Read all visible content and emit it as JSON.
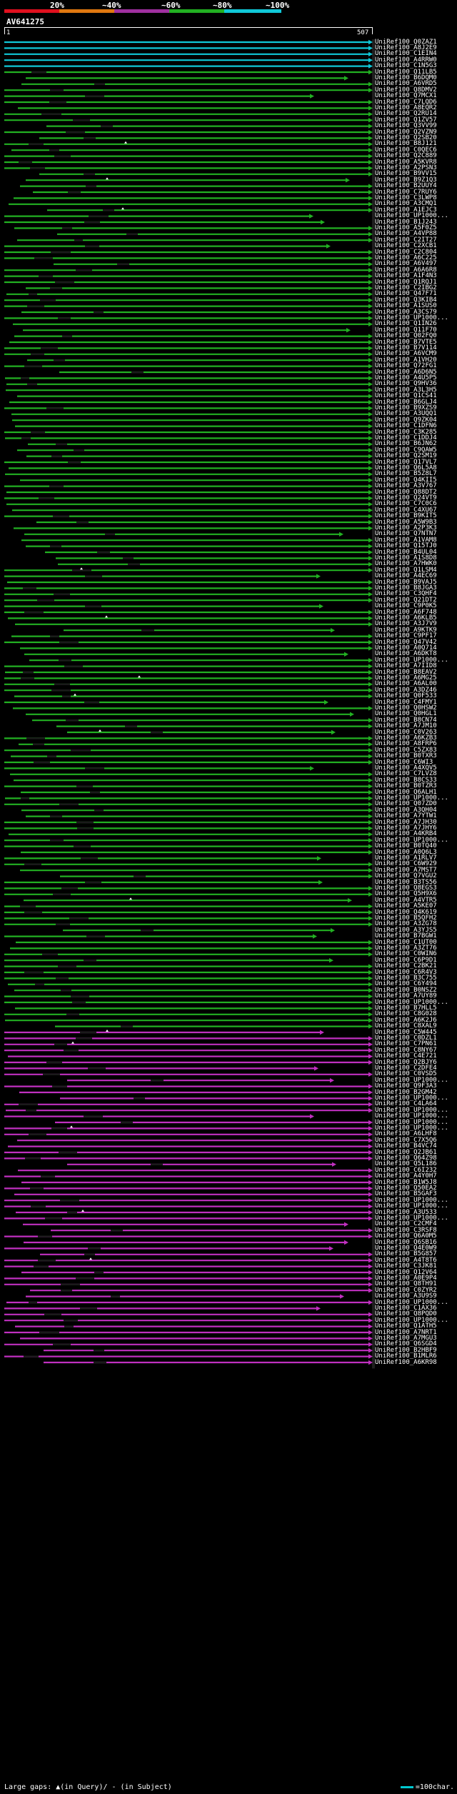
{
  "query_id": "AV641275",
  "ruler": {
    "start": "1",
    "end": "507"
  },
  "identity_legend": [
    {
      "label": "20%",
      "color": "#e0101e"
    },
    {
      "label": "~40%",
      "color": "#e07810"
    },
    {
      "label": "~60%",
      "color": "#a030a0"
    },
    {
      "label": "~80%",
      "color": "#22b022"
    },
    {
      "label": "~100%",
      "color": "#10c8d8"
    }
  ],
  "footer": {
    "gaps_text": "Large gaps: ▲(in Query)/ - (in Subject)",
    "scale_text": "=100char."
  },
  "hits": [
    "UniRef100_Q0ZAZ1",
    "UniRef100_A8J2E9",
    "UniRef100_C1EIN4",
    "UniRef100_A4RRW0",
    "UniRef100_C1N5G3",
    "UniRef100_Q11LB5",
    "UniRef100_B6DQM0",
    "UniRef100_A6VRD5",
    "UniRef100_Q8DMV2",
    "UniRef100_Q7MCX1",
    "UniRef100_C7LQD6",
    "UniRef100_A8EQR2",
    "UniRef100_Q2RU14",
    "UniRef100_Q1ZV57",
    "UniRef100_Q3VV99",
    "UniRef100_Q2VZN9",
    "UniRef100_Q2SB20",
    "UniRef100_B8J121",
    "UniRef100_C0QEC6",
    "UniRef100_Q2C889",
    "UniRef100_A5KVR8",
    "UniRef100_A2PSN3",
    "UniRef100_B9VV15",
    "UniRef100_B9Z1Q3",
    "UniRef100_B2UUY4",
    "UniRef100_C7RUY6",
    "UniRef100_C3LWP8",
    "UniRef100_A3CMQ1",
    "UniRef100_A1EJC3",
    "UniRef100_UP1000...",
    "UniRef100_B1J243",
    "UniRef100_A5F0Z5",
    "UniRef100_A4VP88",
    "UniRef100_C2IT27",
    "UniRef100_C2XCB1",
    "UniRef100_C2C804",
    "UniRef100_A6C225",
    "UniRef100_A6V497",
    "UniRef100_A6A6R8",
    "UniRef100_A1F4N3",
    "UniRef100_Q1RQJ1",
    "UniRef100_C2IBG2",
    "UniRef100_Q47F71",
    "UniRef100_Q3KIB4",
    "UniRef100_A1SUS0",
    "UniRef100_A3CS79",
    "UniRef100_UP1000...",
    "UniRef100_Q1IN26",
    "UniRef100_Q11F70",
    "UniRef100_Q02FQ0",
    "UniRef100_B7VTE5",
    "UniRef100_B7V114",
    "UniRef100_A6VCM9",
    "UniRef100_A1VH20",
    "UniRef100_Q72FG1",
    "UniRef100_A6D6N5",
    "UniRef100_A4U5P5",
    "UniRef100_Q9HV36",
    "UniRef100_A3L3H5",
    "UniRef100_Q1CS41",
    "UniRef100_B6GLJ4",
    "UniRef100_B9XZS9",
    "UniRef100_A3UQQ1",
    "UniRef100_Q9ZK04",
    "UniRef100_C1DFN6",
    "UniRef100_C3K285",
    "UniRef100_C1DDJ4",
    "UniRef100_B6JN62",
    "UniRef100_C9QAW5",
    "UniRef100_Q2SM19",
    "UniRef100_Q17VL7",
    "UniRef100_Q6L5A8",
    "UniRef100_B5Z8L7",
    "UniRef100_Q4KII5",
    "UniRef100_A3V767",
    "UniRef100_Q88DT2",
    "UniRef100_Q24VT9",
    "UniRef100_C7C0C6",
    "UniRef100_C4XU67",
    "UniRef100_B9KIT5",
    "UniRef100_A5W9B3",
    "UniRef100_A2P3K3",
    "UniRef100_Q7NTN7",
    "UniRef100_A1VAM8",
    "UniRef100_Q15TJ0",
    "UniRef100_B4UL04",
    "UniRef100_A1S8D8",
    "UniRef100_A7HWK0",
    "UniRef100_Q1LSM4",
    "UniRef100_A4EC69",
    "UniRef100_B9VAJ5",
    "UniRef100_B8JGA3",
    "UniRef100_C3QHF4",
    "UniRef100_Q21DT2",
    "UniRef100_C9P0K5",
    "UniRef100_A6F748",
    "UniRef100_A6KLB5",
    "UniRef100_A3J7V9",
    "UniRef100_A9KTK9",
    "UniRef100_C9PF17",
    "UniRef100_Q47V42",
    "UniRef100_A0Q714",
    "UniRef100_A6DKT8",
    "UniRef100_UP1000...",
    "UniRef100_A7IID8",
    "UniRef100_B8EAV2",
    "UniRef100_A6MG25",
    "UniRef100_A6AL00",
    "UniRef100_A3DZ46",
    "UniRef100_Q0F533",
    "UniRef100_C4FMY1",
    "UniRef100_Q0HSW2",
    "UniRef100_Q0HGL1",
    "UniRef100_B8CN74",
    "UniRef100_A7JM10",
    "UniRef100_C0V263",
    "UniRef100_A6KZB3",
    "UniRef100_A8FRP6",
    "UniRef100_C5ZX83",
    "UniRef100_B0TXR3",
    "UniRef100_C6WI3",
    "UniRef100_A4XQV5",
    "UniRef100_C7LVZ8",
    "UniRef100_B8CS33",
    "UniRef100_B0TZR3",
    "UniRef100_Q6ALH1",
    "UniRef100_UP1000...",
    "UniRef100_Q07ZD0",
    "UniRef100_A3QH04",
    "UniRef100_A7YTW1",
    "UniRef100_A7JH30",
    "UniRef100_A7JHY6",
    "UniRef100_A4KRB4",
    "UniRef100_UP1000...",
    "UniRef100_B0TQ40",
    "UniRef100_A0Q6L3",
    "UniRef100_A1RLV7",
    "UniRef100_C6W929",
    "UniRef100_A7MST7",
    "UniRef100_Q7VGU2",
    "UniRef100_B3TS56",
    "UniRef100_Q8EGS3",
    "UniRef100_Q5H9X6",
    "UniRef100_A4VTR5",
    "UniRef100_A5KE07",
    "UniRef100_Q4K619",
    "UniRef100_B5QFH2",
    "UniRef100_A3ZG78",
    "UniRef100_A3YJS5",
    "UniRef100_B7BGW1",
    "UniRef100_C1UT00",
    "UniRef100_A3ZT76",
    "UniRef100_C0WIN6",
    "UniRef100_C6P9D1",
    "UniRef100_C2BK21",
    "UniRef100_C6R4V3",
    "UniRef100_B3C755",
    "UniRef100_C6Y494",
    "UniRef100_B0NSZ2",
    "UniRef100_A7UY89",
    "UniRef100_UP1000...",
    "UniRef100_B7HLL5",
    "UniRef100_C8G028",
    "UniRef100_A6K2J6",
    "UniRef100_C8XAL9",
    "UniRef100_C5W445",
    "UniRef100_C0DZL1",
    "UniRef100_C7PN61",
    "UniRef100_C8NY67",
    "UniRef100_C4E721",
    "UniRef100_Q2BJY6",
    "UniRef100_C2DFE4",
    "UniRef100_C0VSD5",
    "UniRef100_UP1000...",
    "UniRef100_Q9F3A3",
    "UniRef100_B2GM42",
    "UniRef100_UP1000...",
    "UniRef100_C4LA64",
    "UniRef100_UP1000...",
    "UniRef100_UP1000...",
    "UniRef100_UP1000...",
    "UniRef100_UP1000...",
    "UniRef100_A6LHF8",
    "UniRef100_C7X5Q6",
    "UniRef100_B4VC74",
    "UniRef100_Q2JB61",
    "UniRef100_Q64Z98",
    "UniRef100_Q5L186",
    "UniRef100_C6I232",
    "UniRef100_A4Y0H7",
    "UniRef100_B1W5J8",
    "UniRef100_Q50EA2",
    "UniRef100_B5GAF3",
    "UniRef100_UP1000...",
    "UniRef100_UP1000...",
    "UniRef100_A3U533",
    "UniRef100_UP1000...",
    "UniRef100_C2CMF4",
    "UniRef100_C3RSF8",
    "UniRef100_Q6A0M5",
    "UniRef100_Q6SB16",
    "UniRef100_Q4E0W9",
    "UniRef100_B5G857",
    "UniRef100_A4T8T6",
    "UniRef100_C3JK81",
    "UniRef100_Q12V64",
    "UniRef100_A0E9P4",
    "UniRef100_Q8TH91",
    "UniRef100_C0ZYR2",
    "UniRef100_A3U9S9",
    "UniRef100_UP1000...",
    "UniRef100_C1AX36",
    "UniRef100_Q8PQD0",
    "UniRef100_UP1000...",
    "UniRef100_Q1ATH5",
    "UniRef100_A7NRT1",
    "UniRef100_A7MGU3",
    "UniRef100_Q6SGD4",
    "UniRef100_B2HBF9",
    "UniRef100_B1MLR6",
    "UniRef100_A6KR98"
  ]
}
